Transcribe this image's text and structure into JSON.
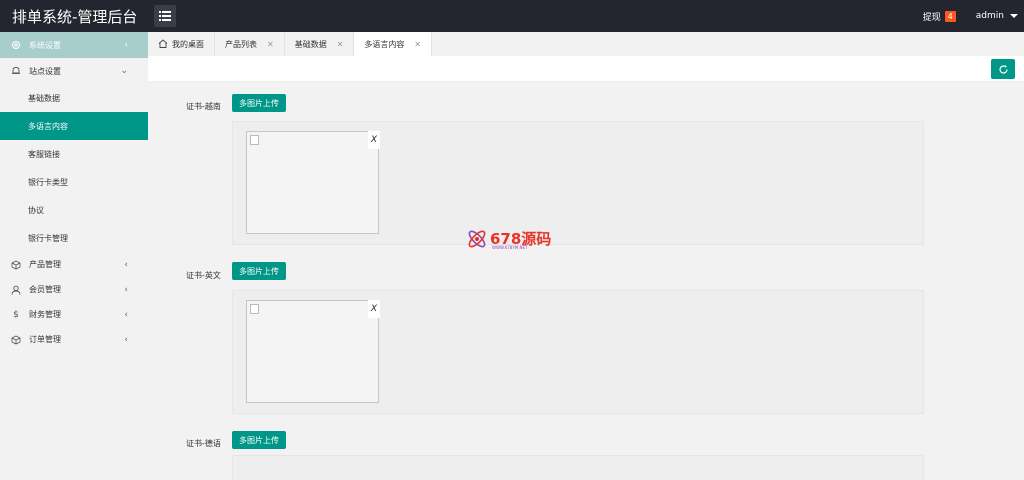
{
  "header": {
    "title": "排单系统-管理后台",
    "withdraw_label": "提现",
    "withdraw_badge": "4",
    "user": "admin"
  },
  "sidebar": {
    "sections": [
      {
        "label": "系统设置",
        "icon": "gear-icon"
      },
      {
        "label": "站点设置",
        "icon": "bell-icon"
      }
    ],
    "sub_items": [
      "基础数据",
      "多语言内容",
      "客服链接",
      "银行卡类型",
      "协议",
      "银行卡管理"
    ],
    "active_sub": "多语言内容",
    "groups": [
      {
        "label": "产品管理",
        "icon": "box-icon"
      },
      {
        "label": "会员管理",
        "icon": "user-icon"
      },
      {
        "label": "财务管理",
        "icon": "dollar-icon"
      },
      {
        "label": "订单管理",
        "icon": "box-icon"
      }
    ]
  },
  "tabs": [
    {
      "label": "我的桌面",
      "closable": false
    },
    {
      "label": "产品列表",
      "closable": true
    },
    {
      "label": "基础数据",
      "closable": true
    },
    {
      "label": "多语言内容",
      "closable": true
    }
  ],
  "fields": [
    {
      "label": "证书-越南",
      "button": "多图片上传",
      "remove": "X"
    },
    {
      "label": "证书-英文",
      "button": "多图片上传",
      "remove": "X"
    },
    {
      "label": "证书-德语",
      "button": "多图片上传"
    }
  ],
  "watermark": {
    "text": "678源码",
    "sub": "WWW.678YM.NET"
  },
  "colors": {
    "primary": "#009688",
    "topbar": "#23262e",
    "badge": "#ff5722",
    "sidebar_section": "#a8cecb"
  }
}
